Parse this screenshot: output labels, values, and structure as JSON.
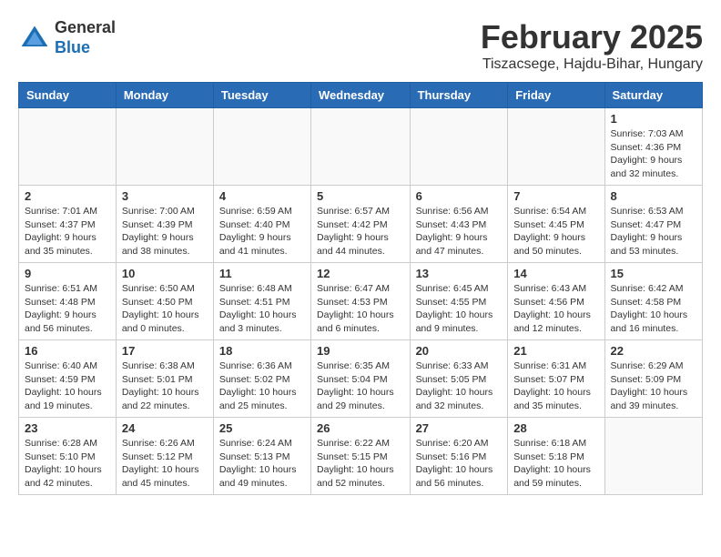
{
  "header": {
    "logo": {
      "general": "General",
      "blue": "Blue"
    },
    "title": "February 2025",
    "subtitle": "Tiszacsege, Hajdu-Bihar, Hungary"
  },
  "days_of_week": [
    "Sunday",
    "Monday",
    "Tuesday",
    "Wednesday",
    "Thursday",
    "Friday",
    "Saturday"
  ],
  "weeks": [
    [
      {
        "day": "",
        "info": ""
      },
      {
        "day": "",
        "info": ""
      },
      {
        "day": "",
        "info": ""
      },
      {
        "day": "",
        "info": ""
      },
      {
        "day": "",
        "info": ""
      },
      {
        "day": "",
        "info": ""
      },
      {
        "day": "1",
        "info": "Sunrise: 7:03 AM\nSunset: 4:36 PM\nDaylight: 9 hours and 32 minutes."
      }
    ],
    [
      {
        "day": "2",
        "info": "Sunrise: 7:01 AM\nSunset: 4:37 PM\nDaylight: 9 hours and 35 minutes."
      },
      {
        "day": "3",
        "info": "Sunrise: 7:00 AM\nSunset: 4:39 PM\nDaylight: 9 hours and 38 minutes."
      },
      {
        "day": "4",
        "info": "Sunrise: 6:59 AM\nSunset: 4:40 PM\nDaylight: 9 hours and 41 minutes."
      },
      {
        "day": "5",
        "info": "Sunrise: 6:57 AM\nSunset: 4:42 PM\nDaylight: 9 hours and 44 minutes."
      },
      {
        "day": "6",
        "info": "Sunrise: 6:56 AM\nSunset: 4:43 PM\nDaylight: 9 hours and 47 minutes."
      },
      {
        "day": "7",
        "info": "Sunrise: 6:54 AM\nSunset: 4:45 PM\nDaylight: 9 hours and 50 minutes."
      },
      {
        "day": "8",
        "info": "Sunrise: 6:53 AM\nSunset: 4:47 PM\nDaylight: 9 hours and 53 minutes."
      }
    ],
    [
      {
        "day": "9",
        "info": "Sunrise: 6:51 AM\nSunset: 4:48 PM\nDaylight: 9 hours and 56 minutes."
      },
      {
        "day": "10",
        "info": "Sunrise: 6:50 AM\nSunset: 4:50 PM\nDaylight: 10 hours and 0 minutes."
      },
      {
        "day": "11",
        "info": "Sunrise: 6:48 AM\nSunset: 4:51 PM\nDaylight: 10 hours and 3 minutes."
      },
      {
        "day": "12",
        "info": "Sunrise: 6:47 AM\nSunset: 4:53 PM\nDaylight: 10 hours and 6 minutes."
      },
      {
        "day": "13",
        "info": "Sunrise: 6:45 AM\nSunset: 4:55 PM\nDaylight: 10 hours and 9 minutes."
      },
      {
        "day": "14",
        "info": "Sunrise: 6:43 AM\nSunset: 4:56 PM\nDaylight: 10 hours and 12 minutes."
      },
      {
        "day": "15",
        "info": "Sunrise: 6:42 AM\nSunset: 4:58 PM\nDaylight: 10 hours and 16 minutes."
      }
    ],
    [
      {
        "day": "16",
        "info": "Sunrise: 6:40 AM\nSunset: 4:59 PM\nDaylight: 10 hours and 19 minutes."
      },
      {
        "day": "17",
        "info": "Sunrise: 6:38 AM\nSunset: 5:01 PM\nDaylight: 10 hours and 22 minutes."
      },
      {
        "day": "18",
        "info": "Sunrise: 6:36 AM\nSunset: 5:02 PM\nDaylight: 10 hours and 25 minutes."
      },
      {
        "day": "19",
        "info": "Sunrise: 6:35 AM\nSunset: 5:04 PM\nDaylight: 10 hours and 29 minutes."
      },
      {
        "day": "20",
        "info": "Sunrise: 6:33 AM\nSunset: 5:05 PM\nDaylight: 10 hours and 32 minutes."
      },
      {
        "day": "21",
        "info": "Sunrise: 6:31 AM\nSunset: 5:07 PM\nDaylight: 10 hours and 35 minutes."
      },
      {
        "day": "22",
        "info": "Sunrise: 6:29 AM\nSunset: 5:09 PM\nDaylight: 10 hours and 39 minutes."
      }
    ],
    [
      {
        "day": "23",
        "info": "Sunrise: 6:28 AM\nSunset: 5:10 PM\nDaylight: 10 hours and 42 minutes."
      },
      {
        "day": "24",
        "info": "Sunrise: 6:26 AM\nSunset: 5:12 PM\nDaylight: 10 hours and 45 minutes."
      },
      {
        "day": "25",
        "info": "Sunrise: 6:24 AM\nSunset: 5:13 PM\nDaylight: 10 hours and 49 minutes."
      },
      {
        "day": "26",
        "info": "Sunrise: 6:22 AM\nSunset: 5:15 PM\nDaylight: 10 hours and 52 minutes."
      },
      {
        "day": "27",
        "info": "Sunrise: 6:20 AM\nSunset: 5:16 PM\nDaylight: 10 hours and 56 minutes."
      },
      {
        "day": "28",
        "info": "Sunrise: 6:18 AM\nSunset: 5:18 PM\nDaylight: 10 hours and 59 minutes."
      },
      {
        "day": "",
        "info": ""
      }
    ]
  ]
}
